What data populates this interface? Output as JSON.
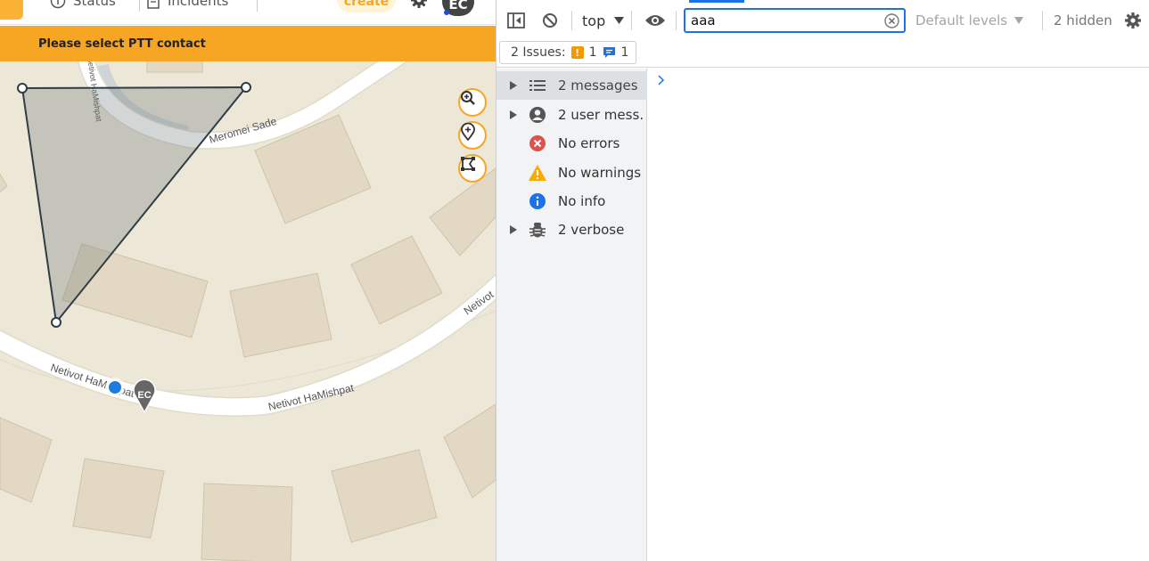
{
  "app": {
    "top_tabs": [
      {
        "label": "Status",
        "icon": "info-circle-icon"
      },
      {
        "label": "Incidents",
        "icon": "document-icon"
      }
    ],
    "create_label": "create",
    "avatar_initials": "EC",
    "banner_text": "Please select PTT contact",
    "accent_color": "#f6a623"
  },
  "map": {
    "streets": [
      {
        "name": "Meromei Sade"
      },
      {
        "name": "Netivot HaMishpat"
      },
      {
        "name": "Netivot HaMishpat"
      },
      {
        "name": "Netivot"
      },
      {
        "name": "Netivot HaMishpat"
      }
    ],
    "marker_initials": "EC",
    "controls": [
      "zoom-icon",
      "location-pin-icon",
      "draw-polygon-icon"
    ]
  },
  "devtools": {
    "context": "top",
    "filter_value": "aaa",
    "levels_label": "Default levels",
    "hidden_label": "2 hidden",
    "issues": {
      "label": "2 Issues:",
      "warnings": "1",
      "info": "1"
    },
    "sidebar": [
      {
        "label": "2 messages",
        "icon": "list-icon",
        "expandable": true
      },
      {
        "label": "2 user mess…",
        "icon": "user-icon",
        "expandable": true
      },
      {
        "label": "No errors",
        "icon": "error-icon",
        "expandable": false
      },
      {
        "label": "No warnings",
        "icon": "warning-icon",
        "expandable": false
      },
      {
        "label": "No info",
        "icon": "info-icon",
        "expandable": false
      },
      {
        "label": "2 verbose",
        "icon": "bug-icon",
        "expandable": true
      }
    ]
  }
}
